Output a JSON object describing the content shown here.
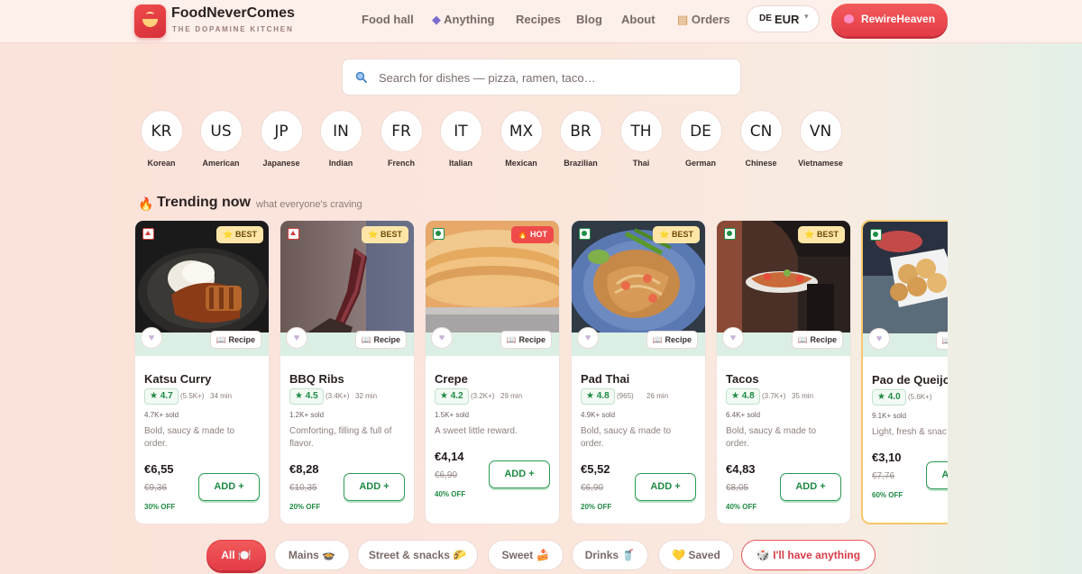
{
  "brand": {
    "name": "FoodNeverComes",
    "tagline": "THE DOPAMINE KITCHEN"
  },
  "nav": [
    {
      "label": "Food hall",
      "icon": ""
    },
    {
      "label": "Anything",
      "icon": "dice-icon"
    },
    {
      "label": "Recipes",
      "icon": ""
    },
    {
      "label": "Blog",
      "icon": ""
    },
    {
      "label": "About",
      "icon": ""
    },
    {
      "label": "Orders",
      "icon": "scroll-icon"
    }
  ],
  "currency": {
    "country": "DE",
    "code": "EUR"
  },
  "user": {
    "name": "RewireHeaven",
    "icon": "brain-icon"
  },
  "search": {
    "placeholder": "Search for dishes — pizza, ramen, taco…",
    "value": ""
  },
  "countries": [
    {
      "code": "KR",
      "name": "Korean"
    },
    {
      "code": "US",
      "name": "American"
    },
    {
      "code": "JP",
      "name": "Japanese"
    },
    {
      "code": "IN",
      "name": "Indian"
    },
    {
      "code": "FR",
      "name": "French"
    },
    {
      "code": "IT",
      "name": "Italian"
    },
    {
      "code": "MX",
      "name": "Mexican"
    },
    {
      "code": "BR",
      "name": "Brazilian"
    },
    {
      "code": "TH",
      "name": "Thai"
    },
    {
      "code": "DE",
      "name": "German"
    },
    {
      "code": "CN",
      "name": "Chinese"
    },
    {
      "code": "VN",
      "name": "Vietnamese"
    }
  ],
  "trending": {
    "title": "Trending now",
    "subtitle": "what everyone's craving",
    "icon": "fire-icon"
  },
  "card_labels": {
    "recipe": "📖 Recipe",
    "add": "ADD +"
  },
  "dishes": [
    {
      "name": "Katsu Curry",
      "rating": "★ 4.7",
      "reviews": "(5.5K+)",
      "time": "34 min",
      "sold": "4.7K+ sold",
      "desc": "Bold, saucy & made to order.",
      "price": "€6,55",
      "old_price": "€9,36",
      "off": "30% OFF",
      "tag": "⭐ BEST",
      "diet": "non-veg"
    },
    {
      "name": "BBQ Ribs",
      "rating": "★ 4.5",
      "reviews": "(3.4K+)",
      "time": "32 min",
      "sold": "1.2K+ sold",
      "desc": "Comforting, filling & full of flavor.",
      "price": "€8,28",
      "old_price": "€10,35",
      "off": "20% OFF",
      "tag": "⭐ BEST",
      "diet": "non-veg"
    },
    {
      "name": "Crepe",
      "rating": "★ 4.2",
      "reviews": "(3.2K+)",
      "time": "29 min",
      "sold": "1.5K+ sold",
      "desc": "A sweet little reward.",
      "price": "€4,14",
      "old_price": "€6,90",
      "off": "40% OFF",
      "tag": "🔥 HOT",
      "diet": "veg"
    },
    {
      "name": "Pad Thai",
      "rating": "★ 4.8",
      "reviews": "(965)",
      "time": "26 min",
      "sold": "4.9K+ sold",
      "desc": "Bold, saucy & made to order.",
      "price": "€5,52",
      "old_price": "€6,90",
      "off": "20% OFF",
      "tag": "⭐ BEST",
      "diet": "veg"
    },
    {
      "name": "Tacos",
      "rating": "★ 4.8",
      "reviews": "(3.7K+)",
      "time": "35 min",
      "sold": "6.4K+ sold",
      "desc": "Bold, saucy & made to order.",
      "price": "€4,83",
      "old_price": "€8,05",
      "off": "40% OFF",
      "tag": "⭐ BEST",
      "diet": "veg"
    },
    {
      "name": "Pao de Queijo",
      "rating": "★ 4.0",
      "reviews": "(5.6K+)",
      "time": "",
      "sold": "9.1K+ sold",
      "desc": "Light, fresh & snac",
      "price": "€3,10",
      "old_price": "€7,76",
      "off": "60% OFF",
      "tag": "",
      "diet": "veg"
    }
  ],
  "filters": [
    {
      "label": "All 🍽️",
      "active": true
    },
    {
      "label": "Mains 🍲",
      "active": false
    },
    {
      "label": "Street & snacks 🌮",
      "active": false
    },
    {
      "label": "Sweet 🍰",
      "active": false
    },
    {
      "label": "Drinks 🥤",
      "active": false
    },
    {
      "label": "💛 Saved",
      "active": false
    },
    {
      "label": "🎲 I'll have anything",
      "active": false
    }
  ],
  "colors": {
    "accent": "#e43c47",
    "green": "#1f8a43",
    "best_tag": "#ffe6a8",
    "hot_tag": "#ef4b4b",
    "background": "#fbe2da"
  }
}
